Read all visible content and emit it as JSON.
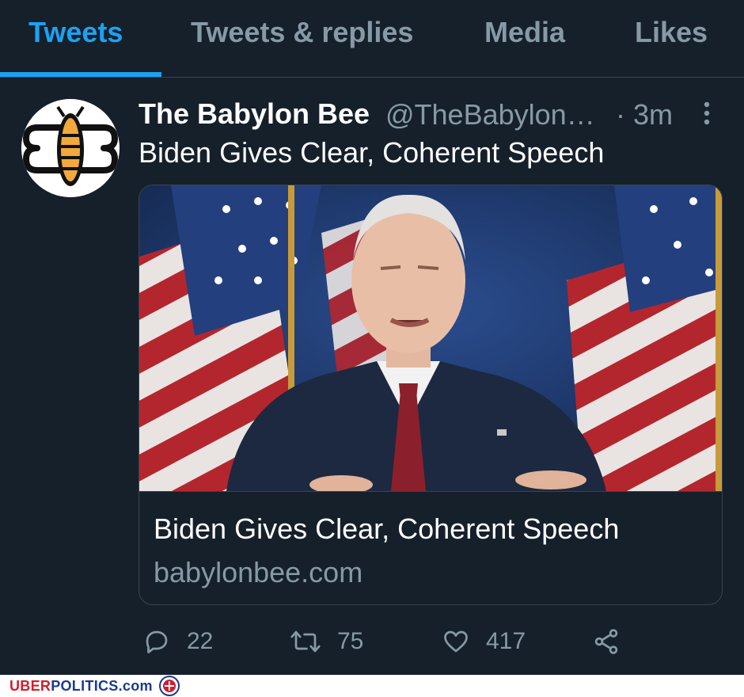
{
  "tabs": [
    {
      "label": "Tweets",
      "active": true
    },
    {
      "label": "Tweets & replies",
      "active": false
    },
    {
      "label": "Media",
      "active": false
    },
    {
      "label": "Likes",
      "active": false
    }
  ],
  "tweet": {
    "author_name": "The Babylon Bee",
    "handle": "@TheBabylonBee",
    "timestamp": "· 3m",
    "text": "Biden Gives Clear, Coherent Speech",
    "card": {
      "title": "Biden Gives Clear, Coherent Speech",
      "domain": "babylonbee.com"
    },
    "actions": {
      "replies": "22",
      "retweets": "75",
      "likes": "417"
    }
  },
  "watermark": {
    "brand_red": "UBER",
    "brand_blue": "POLITICS.com"
  },
  "colors": {
    "background": "#15202b",
    "accent": "#1da1f2",
    "secondary_text": "#8899a6",
    "border": "#38444d"
  },
  "icons": [
    "more-vertical-icon",
    "reply-icon",
    "retweet-icon",
    "like-icon",
    "share-icon"
  ]
}
